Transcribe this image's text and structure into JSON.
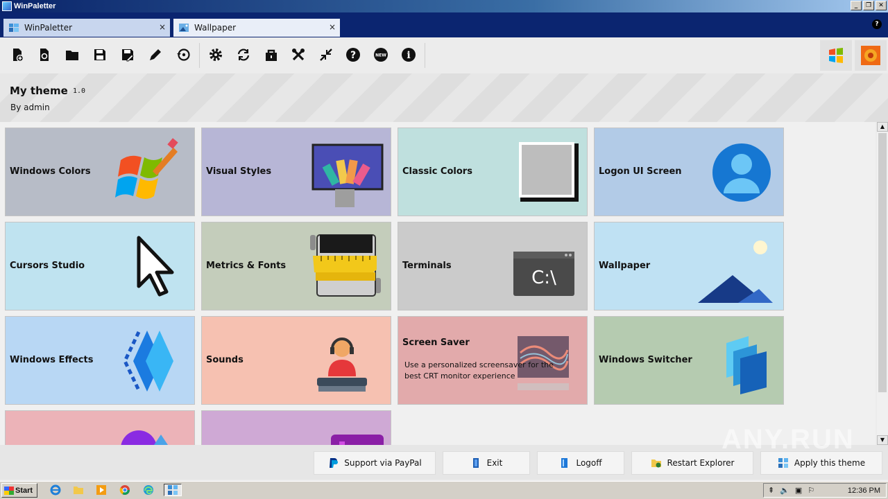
{
  "window": {
    "title": "WinPaletter"
  },
  "tabs": [
    {
      "label": "WinPaletter",
      "close": "×"
    },
    {
      "label": "Wallpaper",
      "close": "×"
    }
  ],
  "help_glyph": "?",
  "toolbar": {
    "icons": [
      "new-file-icon",
      "reload-file-icon",
      "open-folder-icon",
      "save-icon",
      "save-as-icon",
      "edit-icon",
      "restore-icon",
      "settings-icon",
      "sync-icon",
      "lock-icon",
      "tools-icon",
      "collapse-icon",
      "help-icon",
      "whats-new-icon",
      "info-icon"
    ],
    "new_badge": "NEW",
    "help_glyph": "?",
    "info_glyph": "i"
  },
  "theme": {
    "name": "My theme",
    "version": "1.0",
    "author": "By admin"
  },
  "cards": [
    {
      "label": "Windows Colors",
      "bg": "#b7bcc7",
      "icon": "windows-logo-icon"
    },
    {
      "label": "Visual Styles",
      "bg": "#b7b6d6",
      "icon": "visual-styles-icon"
    },
    {
      "label": "Classic Colors",
      "bg": "#bfe0de",
      "icon": "classic-window-icon"
    },
    {
      "label": "Logon UI Screen",
      "bg": "#b2cbe7",
      "icon": "user-icon"
    },
    {
      "label": "Cursors Studio",
      "bg": "#bfe3f0",
      "icon": "cursor-icon"
    },
    {
      "label": "Metrics & Fonts",
      "bg": "#c4cdbb",
      "icon": "ruler-icon"
    },
    {
      "label": "Terminals",
      "bg": "#cbcbcb",
      "icon": "terminal-icon",
      "terminal_text": "C:\\"
    },
    {
      "label": "Wallpaper",
      "bg": "#bfe1f3",
      "icon": "landscape-icon"
    },
    {
      "label": "Windows Effects",
      "bg": "#b8d7f4",
      "icon": "effects-icon"
    },
    {
      "label": "Sounds",
      "bg": "#f6c1b1",
      "icon": "sounds-icon"
    },
    {
      "label": "Screen Saver",
      "bg": "#e2aaab",
      "icon": "screensaver-icon",
      "description": "Use a personalized screensaver for the best CRT monitor experience"
    },
    {
      "label": "Windows Switcher",
      "bg": "#b5cbb0",
      "icon": "switcher-icon"
    },
    {
      "label": "",
      "bg": "#ecb3b8",
      "icon": "shapes-icon"
    },
    {
      "label": "",
      "bg": "#cfa9d5",
      "icon": "apps-icon"
    }
  ],
  "footer": {
    "buttons": [
      {
        "label": "Support via PayPal",
        "icon": "paypal-icon"
      },
      {
        "label": "Exit",
        "icon": "exit-icon"
      },
      {
        "label": "Logoff",
        "icon": "logoff-icon"
      },
      {
        "label": "Restart Explorer",
        "icon": "explorer-icon"
      },
      {
        "label": "Apply this theme",
        "icon": "apply-icon"
      }
    ]
  },
  "watermark": "ANY.RUN",
  "taskbar": {
    "start_label": "Start",
    "clock": "12:36 PM"
  }
}
